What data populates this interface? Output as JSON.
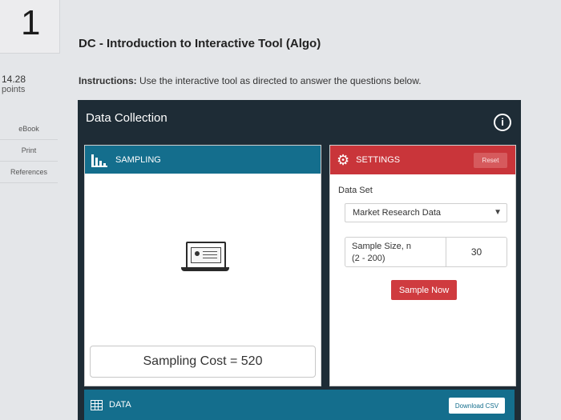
{
  "question": {
    "number": "1",
    "points_value": "14.28",
    "points_label": "points"
  },
  "sidebar": {
    "items": [
      {
        "label": "eBook"
      },
      {
        "label": "Print"
      },
      {
        "label": "References"
      }
    ]
  },
  "header": {
    "title": "DC - Introduction to Interactive Tool (Algo)",
    "instructions_label": "Instructions:",
    "instructions_text": "Use the interactive tool as directed to answer the questions below."
  },
  "tool": {
    "title": "Data Collection",
    "info_glyph": "i",
    "sampling": {
      "header": "SAMPLING",
      "cost_text": "Sampling Cost  =  520"
    },
    "settings": {
      "header": "SETTINGS",
      "reset_label": "Reset",
      "data_set_label": "Data Set",
      "data_set_value": "Market Research Data",
      "sample_size_label": "Sample Size, n",
      "sample_size_range": "(2 - 200)",
      "sample_size_value": "30",
      "sample_now_label": "Sample Now"
    },
    "data": {
      "header": "DATA",
      "download_label": "Download CSV"
    }
  },
  "colors": {
    "tool_bg": "#1e2c36",
    "sampling_blue": "#146e8d",
    "settings_red": "#c9353a"
  },
  "icons": [
    "info-icon",
    "bar-chart-icon",
    "gear-icon",
    "chevron-down-icon",
    "laptop-icon",
    "table-icon"
  ]
}
